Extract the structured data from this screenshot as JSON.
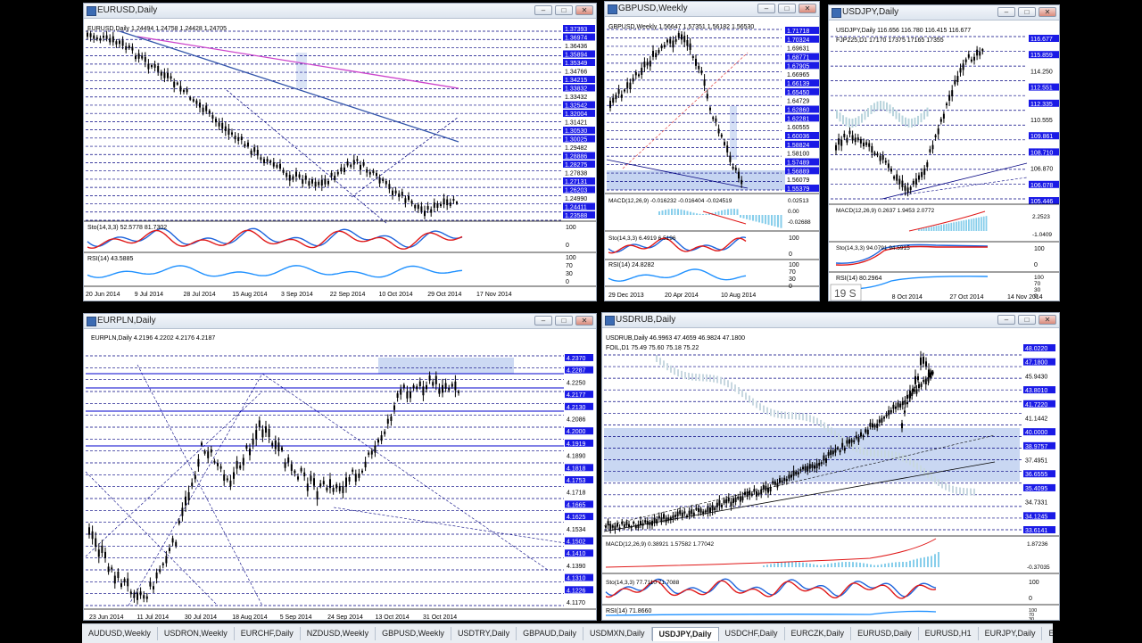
{
  "windows": {
    "eurusd": {
      "title": "EURUSD,Daily",
      "header": "EURUSD,Daily  1.24494 1.24758 1.24428 1.24705",
      "stoch_label": "Sto(14,3,3) 52.5778 81.7302",
      "rsi_label": "RSI(14) 43.5885",
      "price_labels": [
        "1.37393",
        "1.36974",
        "1.36436",
        "1.35894",
        "1.35349",
        "1.34766",
        "1.34215",
        "1.33832",
        "1.33432",
        "1.32542",
        "1.32004",
        "1.31421",
        "1.30530",
        "1.30025",
        "1.29482",
        "1.28886",
        "1.28275",
        "1.27838",
        "1.27131",
        "1.26203",
        "1.24990",
        "1.24411",
        "1.23588"
      ],
      "stoch_scale": [
        "100",
        "0"
      ],
      "rsi_scale": [
        "100",
        "70",
        "30",
        "0"
      ],
      "date_labels": [
        "20 Jun 2014",
        "9 Jul 2014",
        "28 Jul 2014",
        "15 Aug 2014",
        "3 Sep 2014",
        "22 Sep 2014",
        "10 Oct 2014",
        "29 Oct 2014",
        "17 Nov 2014"
      ]
    },
    "gbpusd": {
      "title": "GBPUSD,Weekly",
      "header": "GBPUSD,Weekly  1.56647 1.57351 1.56182 1.56530",
      "macd_label": "MACD(12,26,9) -0.016232 -0.016404 -0.024519",
      "stoch_label": "Sto(14,3,3) 6.4919 6.5196",
      "rsi_label": "RSI(14) 24.8282",
      "price_labels": [
        "1.71718",
        "1.70324",
        "1.69631",
        "1.68771",
        "1.67905",
        "1.66965",
        "1.66139",
        "1.65450",
        "1.64729",
        "1.62860",
        "1.62281",
        "1.60555",
        "1.60036",
        "1.58824",
        "1.58100",
        "1.57489",
        "1.56889",
        "1.56079",
        "1.55379"
      ],
      "macd_scale": [
        "0.02513",
        "0.00",
        "-0.02688"
      ],
      "stoch_scale": [
        "100",
        "0"
      ],
      "rsi_scale": [
        "100",
        "70",
        "30",
        "0"
      ],
      "date_labels": [
        "29 Dec 2013",
        "20 Apr 2014",
        "10 Aug 2014"
      ]
    },
    "usdjpy": {
      "title": "USDJPY,Daily",
      "header": "USDJPY,Daily  116.656 116.780 116.415 116.677",
      "sub_header": "FJP225,D1 17170 17375 17165 17355",
      "macd_label": "MACD(12,26,9) 0.2637 1.9453 2.0772",
      "stoch_label": "Sto(14,3,3) 94.0791 94.5915",
      "rsi_label": "RSI(14) 80.2964",
      "price_labels": [
        "116.677",
        "115.859",
        "114.250",
        "112.551",
        "112.335",
        "110.555",
        "109.861",
        "108.710",
        "106.870",
        "106.078",
        "105.446"
      ],
      "macd_scale": [
        "2.2523",
        "-1.0409"
      ],
      "stoch_scale": [
        "100",
        "0"
      ],
      "rsi_scale": [
        "100",
        "70",
        "30",
        "0"
      ],
      "date_labels": [
        "014",
        "8 Oct 2014",
        "27 Oct 2014",
        "14 Nov 2014"
      ],
      "overlay_text": "19 S"
    },
    "eurpln": {
      "title": "EURPLN,Daily",
      "header": "EURPLN,Daily  4.2196 4.2202 4.2176 4.2187",
      "price_labels": [
        "4.2370",
        "4.2287",
        "4.2250",
        "4.2177",
        "4.2130",
        "4.2086",
        "4.2000",
        "4.1919",
        "4.1890",
        "4.1818",
        "4.1753",
        "4.1718",
        "4.1665",
        "4.1625",
        "4.1534",
        "4.1502",
        "4.1410",
        "4.1390",
        "4.1310",
        "4.1226",
        "4.1170"
      ],
      "date_labels": [
        "23 Jun 2014",
        "11 Jul 2014",
        "30 Jul 2014",
        "18 Aug 2014",
        "5 Sep 2014",
        "24 Sep 2014",
        "13 Oct 2014",
        "31 Oct 2014"
      ]
    },
    "usdrub": {
      "title": "USDRUB,Daily",
      "header": "USDRUB,Daily  46.9963 47.4659 46.9824 47.1800",
      "sub_header": "FOIL,D1 75.49 75.60 75.18 75.22",
      "macd_label": "MACD(12,26,9) 0.38921 1.57582 1.77042",
      "stoch_label": "Sto(14,3,3) 77.7110 71.7088",
      "rsi_label": "RSI(14) 71.8660",
      "price_labels": [
        "48.0220",
        "47.1800",
        "45.9430",
        "43.8010",
        "41.7220",
        "41.1442",
        "40.0000",
        "38.9757",
        "37.4951",
        "36.6555",
        "35.4095",
        "34.7331",
        "34.1245",
        "33.6141"
      ],
      "macd_scale": [
        "1.87236",
        "-0.37035"
      ],
      "stoch_scale": [
        "100",
        "0"
      ],
      "rsi_scale": [
        "100",
        "70",
        "30"
      ]
    }
  },
  "tabs": [
    "AUDUSD,Weekly",
    "USDRON,Weekly",
    "EURCHF,Daily",
    "NZDUSD,Weekly",
    "GBPUSD,Weekly",
    "USDTRY,Daily",
    "GBPAUD,Daily",
    "USDMXN,Daily",
    "USDJPY,Daily",
    "USDCHF,Daily",
    "EURCZK,Daily",
    "EURUSD,Daily",
    "EURUSD,H1",
    "EURJPY,Daily",
    "E"
  ],
  "active_tab": "USDJPY,Daily",
  "colors": {
    "bg": "#ffffff",
    "candle": "#000000",
    "label_box": "#1a1ae6",
    "stoch_main": "#1e64dc",
    "stoch_signal": "#e01818",
    "rsi": "#1e90ff",
    "macd": "#87ceeb",
    "grid_dash": "#000080",
    "zone": "#b7c9ee"
  }
}
